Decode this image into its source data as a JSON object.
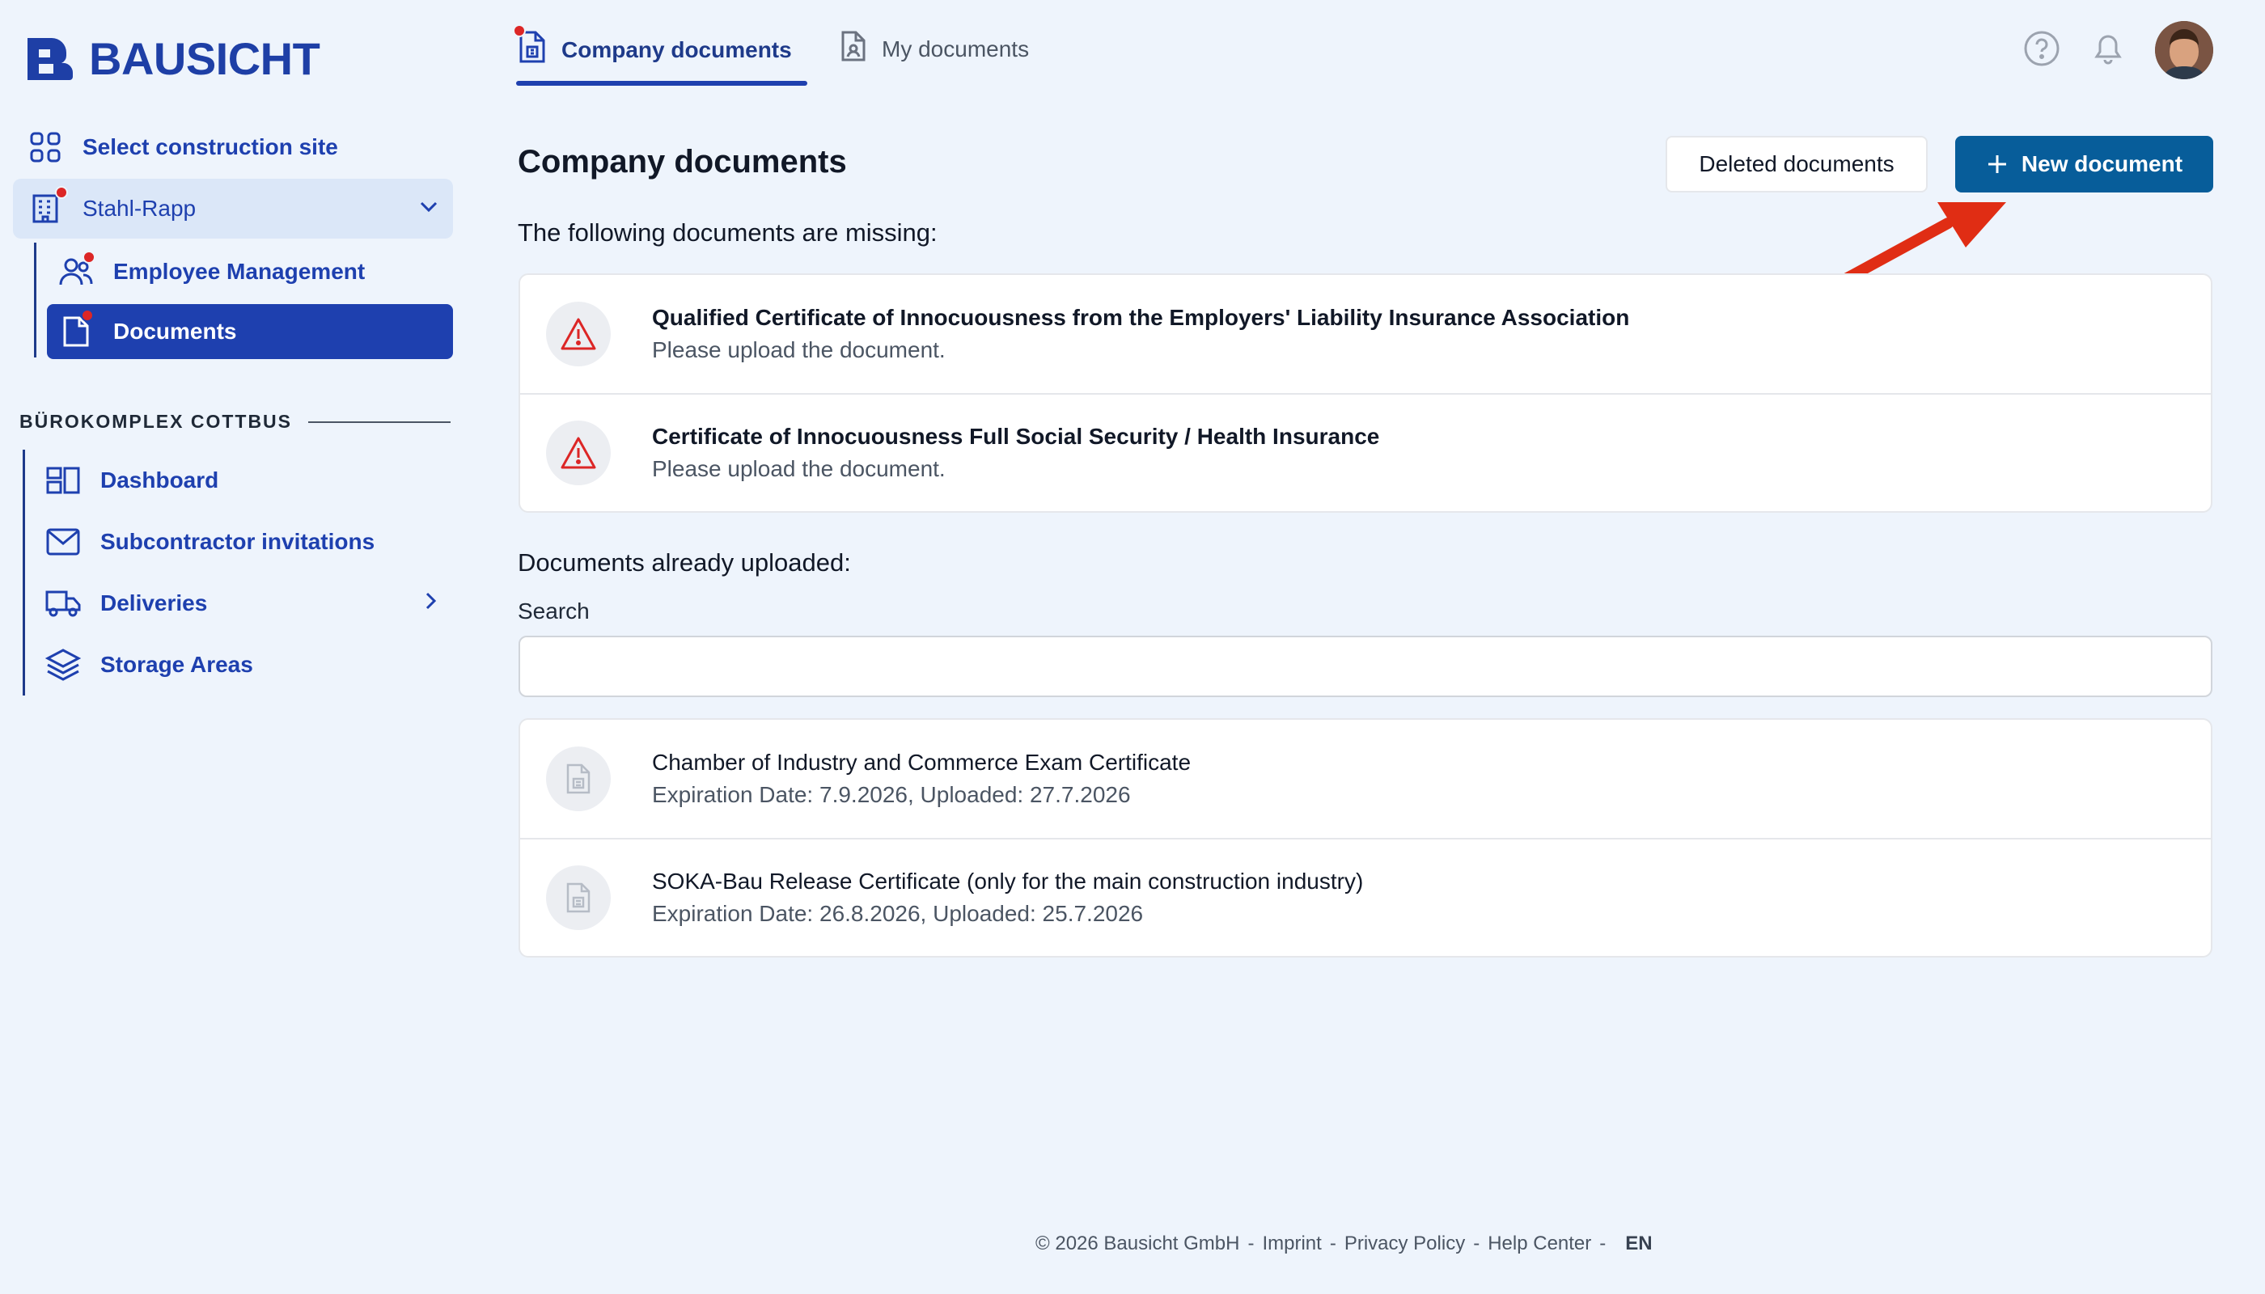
{
  "brand": {
    "name": "BAUSICHT"
  },
  "sidebar": {
    "select_site": "Select construction site",
    "company": "Stahl-Rapp",
    "company_items": [
      {
        "label": "Employee Management"
      },
      {
        "label": "Documents"
      }
    ],
    "section_title": "BÜROKOMPLEX COTTBUS",
    "site_items": [
      {
        "label": "Dashboard"
      },
      {
        "label": "Subcontractor invitations"
      },
      {
        "label": "Deliveries"
      },
      {
        "label": "Storage Areas"
      }
    ]
  },
  "tabs": [
    {
      "label": "Company documents"
    },
    {
      "label": "My documents"
    }
  ],
  "main": {
    "title": "Company documents",
    "deleted_button": "Deleted documents",
    "new_button": "New document",
    "missing_heading": "The following documents are missing:",
    "missing": [
      {
        "title": "Qualified Certificate of Innocuousness from the Employers' Liability Insurance Association",
        "note": "Please upload the document."
      },
      {
        "title": "Certificate of Innocuousness Full Social Security / Health Insurance",
        "note": "Please upload the document."
      }
    ],
    "uploaded_heading": "Documents already uploaded:",
    "search_label": "Search",
    "search_value": "",
    "uploaded": [
      {
        "title": "Chamber of Industry and Commerce Exam Certificate",
        "meta": "Expiration Date: 7.9.2026, Uploaded: 27.7.2026"
      },
      {
        "title": "SOKA-Bau Release Certificate (only for the main construction industry)",
        "meta": "Expiration Date: 26.8.2026, Uploaded: 25.7.2026"
      }
    ]
  },
  "footer": {
    "copyright": "© 2026 Bausicht GmbH",
    "links": [
      "Imprint",
      "Privacy Policy",
      "Help Center"
    ],
    "sep": "-",
    "lang": "EN"
  },
  "colors": {
    "primary": "#1e40af",
    "action": "#075d9a",
    "alert": "#dc2626",
    "background": "#eef4fc"
  }
}
